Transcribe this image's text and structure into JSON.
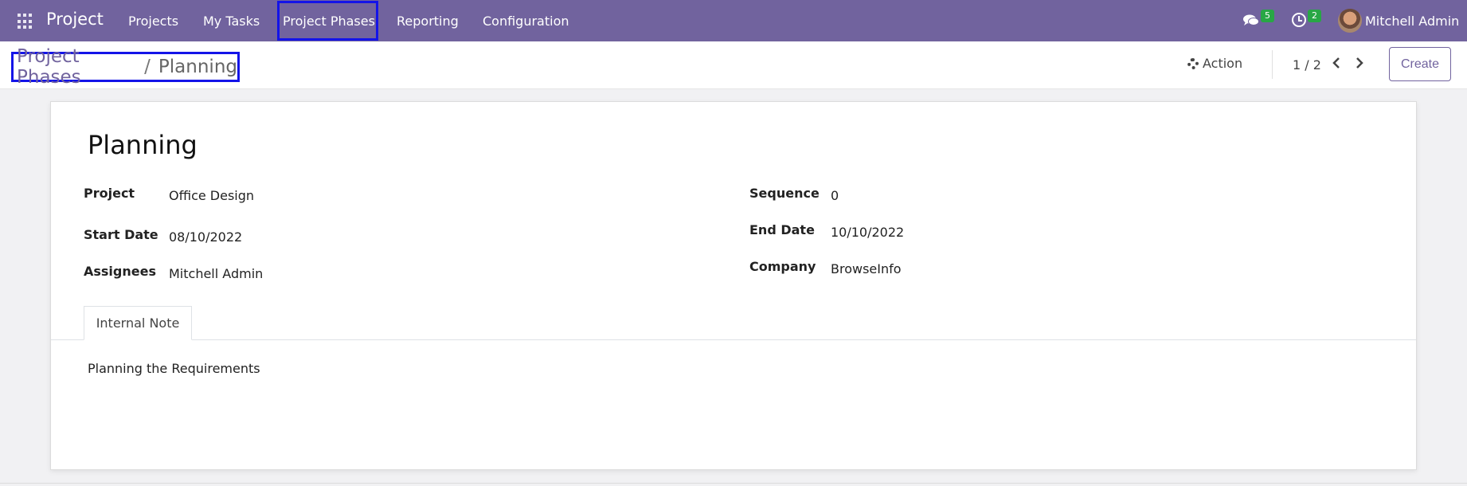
{
  "navbar": {
    "brand": "Project",
    "menu": [
      "Projects",
      "My Tasks",
      "Project Phases",
      "Reporting",
      "Configuration"
    ],
    "messages_count": "5",
    "activities_count": "2",
    "user": "Mitchell Admin"
  },
  "breadcrumb": {
    "parent": "Project Phases",
    "separator": "/",
    "current": "Planning"
  },
  "control": {
    "action_label": "Action",
    "pager": "1 / 2",
    "create_label": "Create"
  },
  "form": {
    "title": "Planning",
    "fields": {
      "project_label": "Project",
      "project_value": "Office Design",
      "start_date_label": "Start Date",
      "start_date_value": "08/10/2022",
      "assignees_label": "Assignees",
      "assignees_value": "Mitchell Admin",
      "sequence_label": "Sequence",
      "sequence_value": "0",
      "end_date_label": "End Date",
      "end_date_value": "10/10/2022",
      "company_label": "Company",
      "company_value": "BrowseInfo"
    },
    "tab_label": "Internal Note",
    "note": "Planning the Requirements"
  },
  "colors": {
    "brand": "#71639e",
    "badge": "#28a745",
    "highlight": "#1414e8"
  }
}
